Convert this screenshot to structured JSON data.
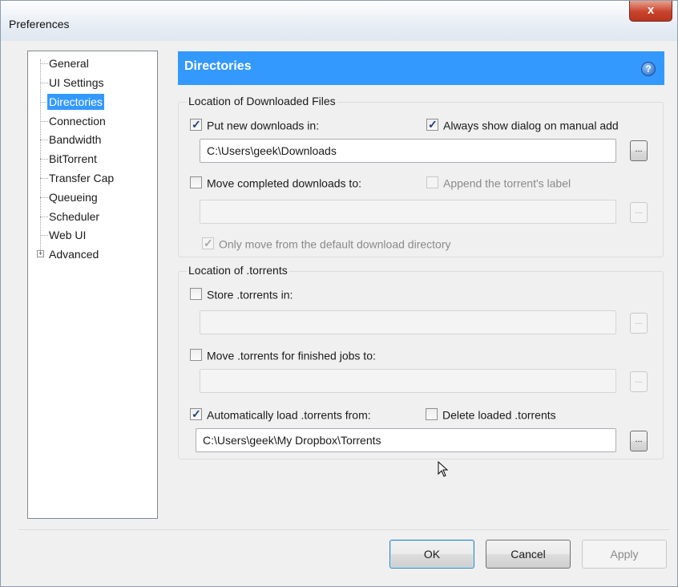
{
  "window": {
    "title": "Preferences",
    "close_glyph": "x"
  },
  "sidebar": {
    "items": [
      {
        "label": "General"
      },
      {
        "label": "UI Settings"
      },
      {
        "label": "Directories",
        "selected": true
      },
      {
        "label": "Connection"
      },
      {
        "label": "Bandwidth"
      },
      {
        "label": "BitTorrent"
      },
      {
        "label": "Transfer Cap"
      },
      {
        "label": "Queueing"
      },
      {
        "label": "Scheduler"
      },
      {
        "label": "Web UI"
      },
      {
        "label": "Advanced",
        "expandable": true
      }
    ],
    "expander_glyph": "+"
  },
  "header": {
    "title": "Directories",
    "help_glyph": "?"
  },
  "downloaded_group": {
    "label": "Location of Downloaded Files",
    "put_new": {
      "label": "Put new downloads in:",
      "checked": true
    },
    "always_show": {
      "label": "Always show dialog on manual add",
      "checked": true
    },
    "download_path": "C:\\Users\\geek\\Downloads",
    "move_completed": {
      "label": "Move completed downloads to:",
      "checked": false
    },
    "append_label": {
      "label": "Append the torrent's label",
      "checked": false,
      "disabled": true
    },
    "move_path": "",
    "only_move": {
      "label": "Only move from the default download directory",
      "checked": true,
      "disabled": true
    },
    "browse_glyph": "..."
  },
  "torrents_group": {
    "label": "Location of .torrents",
    "store": {
      "label": "Store .torrents in:",
      "checked": false
    },
    "store_path": "",
    "move_finished": {
      "label": "Move .torrents for finished jobs to:",
      "checked": false
    },
    "move_finished_path": "",
    "auto_load": {
      "label": "Automatically load .torrents from:",
      "checked": true
    },
    "delete_loaded": {
      "label": "Delete loaded .torrents",
      "checked": false
    },
    "auto_load_path": "C:\\Users\\geek\\My Dropbox\\Torrents",
    "browse_glyph": "..."
  },
  "footer": {
    "ok": "OK",
    "cancel": "Cancel",
    "apply": "Apply"
  },
  "icons": {
    "cursor": "mouse-pointer-icon",
    "help": "help-icon",
    "close": "close-icon"
  },
  "colors": {
    "accent": "#3399ff",
    "window_bg": "#f0f0f0"
  }
}
